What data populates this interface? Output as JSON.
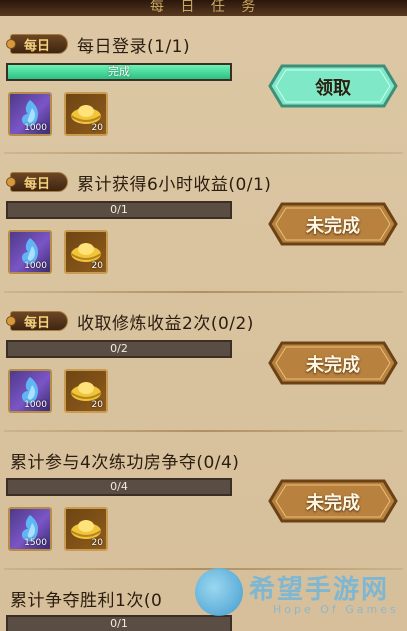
{
  "header": {
    "title": "每 日 任 务"
  },
  "tasks": [
    {
      "daily_tag": "每日",
      "title": "每日登录(1/1)",
      "progress_text": "完成",
      "progress": 1.0,
      "rewards": [
        {
          "icon": "soul-flame-icon",
          "qty": "1000"
        },
        {
          "icon": "gold-ingot-icon",
          "qty": "20"
        }
      ],
      "button": "领取",
      "state": "claimable"
    },
    {
      "daily_tag": "每日",
      "title": "累计获得6小时收益(0/1)",
      "progress_text": "0/1",
      "progress": 0.0,
      "rewards": [
        {
          "icon": "soul-flame-icon",
          "qty": "1000"
        },
        {
          "icon": "gold-ingot-icon",
          "qty": "20"
        }
      ],
      "button": "未完成",
      "state": "incomplete"
    },
    {
      "daily_tag": "每日",
      "title": "收取修炼收益2次(0/2)",
      "progress_text": "0/2",
      "progress": 0.0,
      "rewards": [
        {
          "icon": "soul-flame-icon",
          "qty": "1000"
        },
        {
          "icon": "gold-ingot-icon",
          "qty": "20"
        }
      ],
      "button": "未完成",
      "state": "incomplete"
    },
    {
      "daily_tag": "",
      "title": "累计参与4次练功房争夺(0/4)",
      "progress_text": "0/4",
      "progress": 0.0,
      "rewards": [
        {
          "icon": "soul-flame-icon",
          "qty": "1500"
        },
        {
          "icon": "gold-ingot-icon",
          "qty": "20"
        }
      ],
      "button": "未完成",
      "state": "incomplete"
    },
    {
      "daily_tag": "",
      "title": "累计争夺胜利1次(0",
      "progress_text": "0/1",
      "progress": 0.0
    }
  ],
  "watermark": {
    "cn": "希望手游网",
    "en": "Hope Of Games"
  },
  "colors": {
    "claim_button": "#7ee8c7",
    "incomplete_button": "#b8813e",
    "progress_fill": "#3ed596",
    "bar_track": "#5a4d44"
  }
}
